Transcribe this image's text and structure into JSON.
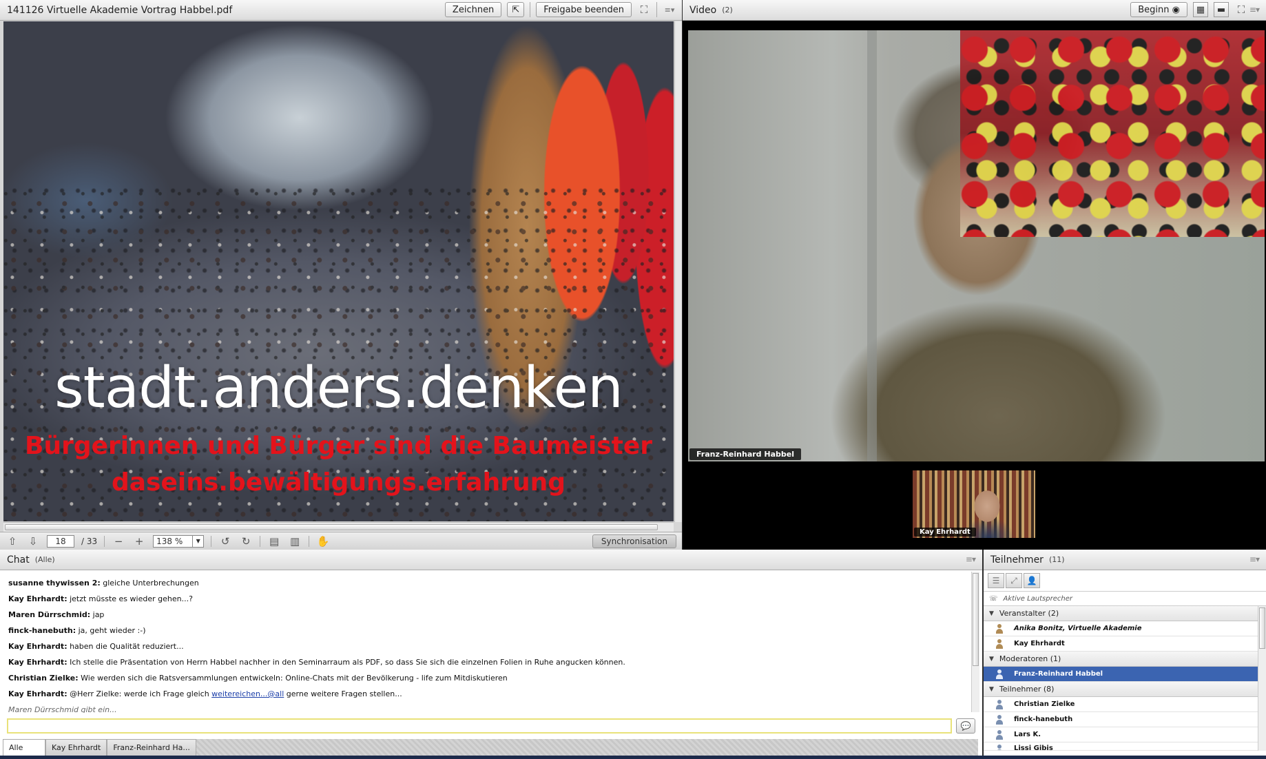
{
  "share": {
    "title": "141126 Virtuelle Akademie Vortrag Habbel.pdf",
    "draw_button": "Zeichnen",
    "stop_share_button": "Freigabe beenden",
    "menu": "≡▾",
    "slide": {
      "title": "stadt.anders.denken",
      "subtitle_1": "Bürgerinnen und Bürger sind die Baumeister",
      "subtitle_2": "daseins.bewältigungs.erfahrung"
    },
    "toolbar": {
      "page": "18",
      "total_pages": "/ 33",
      "zoom": "138 %",
      "sync_button": "Synchronisation"
    }
  },
  "video": {
    "title": "Video",
    "count": "(2)",
    "start_button": "Beginn",
    "menu": "≡▾",
    "main_label": "Franz-Reinhard Habbel",
    "thumb_label": "Kay Ehrhardt"
  },
  "chat": {
    "title": "Chat",
    "scope": "(Alle)",
    "menu": "≡▾",
    "messages": [
      {
        "who": "susanne thywissen 2:",
        "text": " gleiche Unterbrechungen"
      },
      {
        "who": "Kay Ehrhardt:",
        "text": " jetzt müsste es wieder gehen...?"
      },
      {
        "who": "Maren Dürrschmid:",
        "text": " jap"
      },
      {
        "who": "finck-hanebuth:",
        "text": " ja, geht wieder :-)"
      },
      {
        "who": "Kay Ehrhardt:",
        "text": " haben die Qualität reduziert..."
      },
      {
        "who": "Kay Ehrhardt:",
        "text": " Ich stelle die Präsentation von Herrn Habbel nachher in den Seminarraum als PDF, so dass Sie sich die einzelnen Folien in Ruhe angucken können."
      },
      {
        "who": "Christian Zielke:",
        "text": " Wie werden sich die Ratsversammlungen entwickeln: Online-Chats mit der Bevölkerung - life zum Mitdiskutieren"
      },
      {
        "who": "Kay Ehrhardt:",
        "text_before": " @Herr Zielke: werde ich Frage gleich ",
        "link": "weitereichen...@all",
        "text_after": " gerne weitere Fragen stellen..."
      }
    ],
    "typing": "Maren Dürrschmid gibt ein...",
    "input_value": "",
    "tabs": [
      "Alle",
      "Kay Ehrhardt",
      "Franz-Reinhard Ha..."
    ]
  },
  "attendees": {
    "title": "Teilnehmer",
    "count": "(11)",
    "menu": "≡▾",
    "active_speakers": "Aktive Lautsprecher",
    "groups": [
      {
        "label": "Veranstalter (2)",
        "members": [
          "Anika Bonitz, Virtuelle Akademie",
          "Kay Ehrhardt"
        ]
      },
      {
        "label": "Moderatoren (1)",
        "members": [
          "Franz-Reinhard Habbel"
        ]
      },
      {
        "label": "Teilnehmer (8)",
        "members": [
          "Christian Zielke",
          "finck-hanebuth",
          "Lars K.",
          "Lissi Gibis"
        ]
      }
    ]
  },
  "colors": {
    "selected_row": "#3b64b1",
    "chat_input_border": "#e9e279",
    "slide_title": "#ffffff",
    "slide_subtitle": "#e3131b"
  }
}
